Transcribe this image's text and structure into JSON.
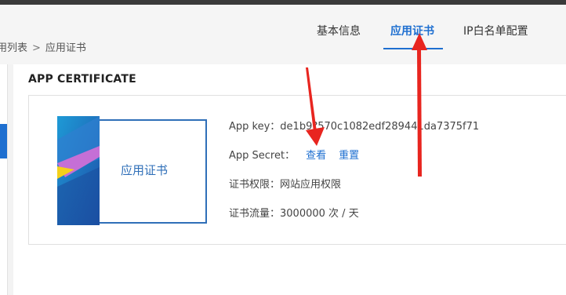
{
  "breadcrumb": {
    "parent": "用列表",
    "separator": ">",
    "current": "应用证书"
  },
  "tabs": [
    {
      "label": "基本信息"
    },
    {
      "label": "应用证书",
      "active": true
    },
    {
      "label": "IP白名单配置"
    }
  ],
  "section_title": "APP CERTIFICATE",
  "certificate": {
    "badge_label": "应用证书"
  },
  "info": {
    "app_key_label": "App key：",
    "app_key_value": "de1b9?570c1082edf289441da7375f71",
    "app_secret_label": "App Secret：",
    "view_label": "查看",
    "reset_label": "重置",
    "permission_label": "证书权限：",
    "permission_value": "网站应用权限",
    "traffic_label": "证书流量：",
    "traffic_value": "3000000 次 / 天"
  },
  "colors": {
    "accent": "#1e6fd0",
    "annotation": "#e8251f"
  },
  "icons": {
    "annotation": "red-arrow-icon"
  }
}
